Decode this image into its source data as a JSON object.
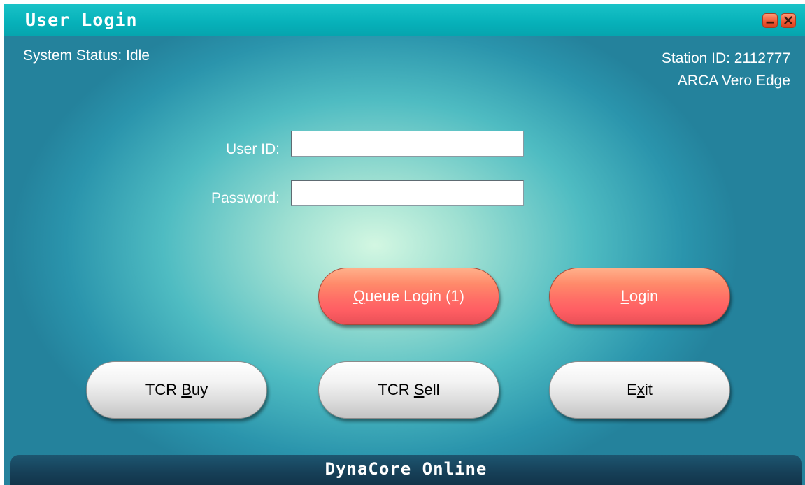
{
  "window": {
    "title": "User Login",
    "minimize_icon": "minimize-icon",
    "close_icon": "close-icon"
  },
  "status": {
    "system_status": "System Status: Idle",
    "station_id": "Station ID: 2112777",
    "product_name": "ARCA Vero Edge"
  },
  "form": {
    "user_id_label": "User ID:",
    "user_id_value": "",
    "password_label": "Password:",
    "password_value": ""
  },
  "buttons": {
    "queue_login": {
      "mnemonic": "Q",
      "rest": "ueue Login (1)"
    },
    "login": {
      "mnemonic": "L",
      "rest": "ogin"
    },
    "tcr_buy": {
      "prefix": "TCR ",
      "mnemonic": "B",
      "rest": "uy"
    },
    "tcr_sell": {
      "prefix": "TCR ",
      "mnemonic": "S",
      "rest": "ell"
    },
    "exit": {
      "prefix": "E",
      "mnemonic": "x",
      "rest": "it"
    }
  },
  "footer": {
    "text": "DynaCore Online"
  },
  "colors": {
    "titlebar": "#07b2ba",
    "accent_button": "#ff6e66",
    "neutral_button": "#dcdcdc",
    "footer": "#163f57"
  }
}
